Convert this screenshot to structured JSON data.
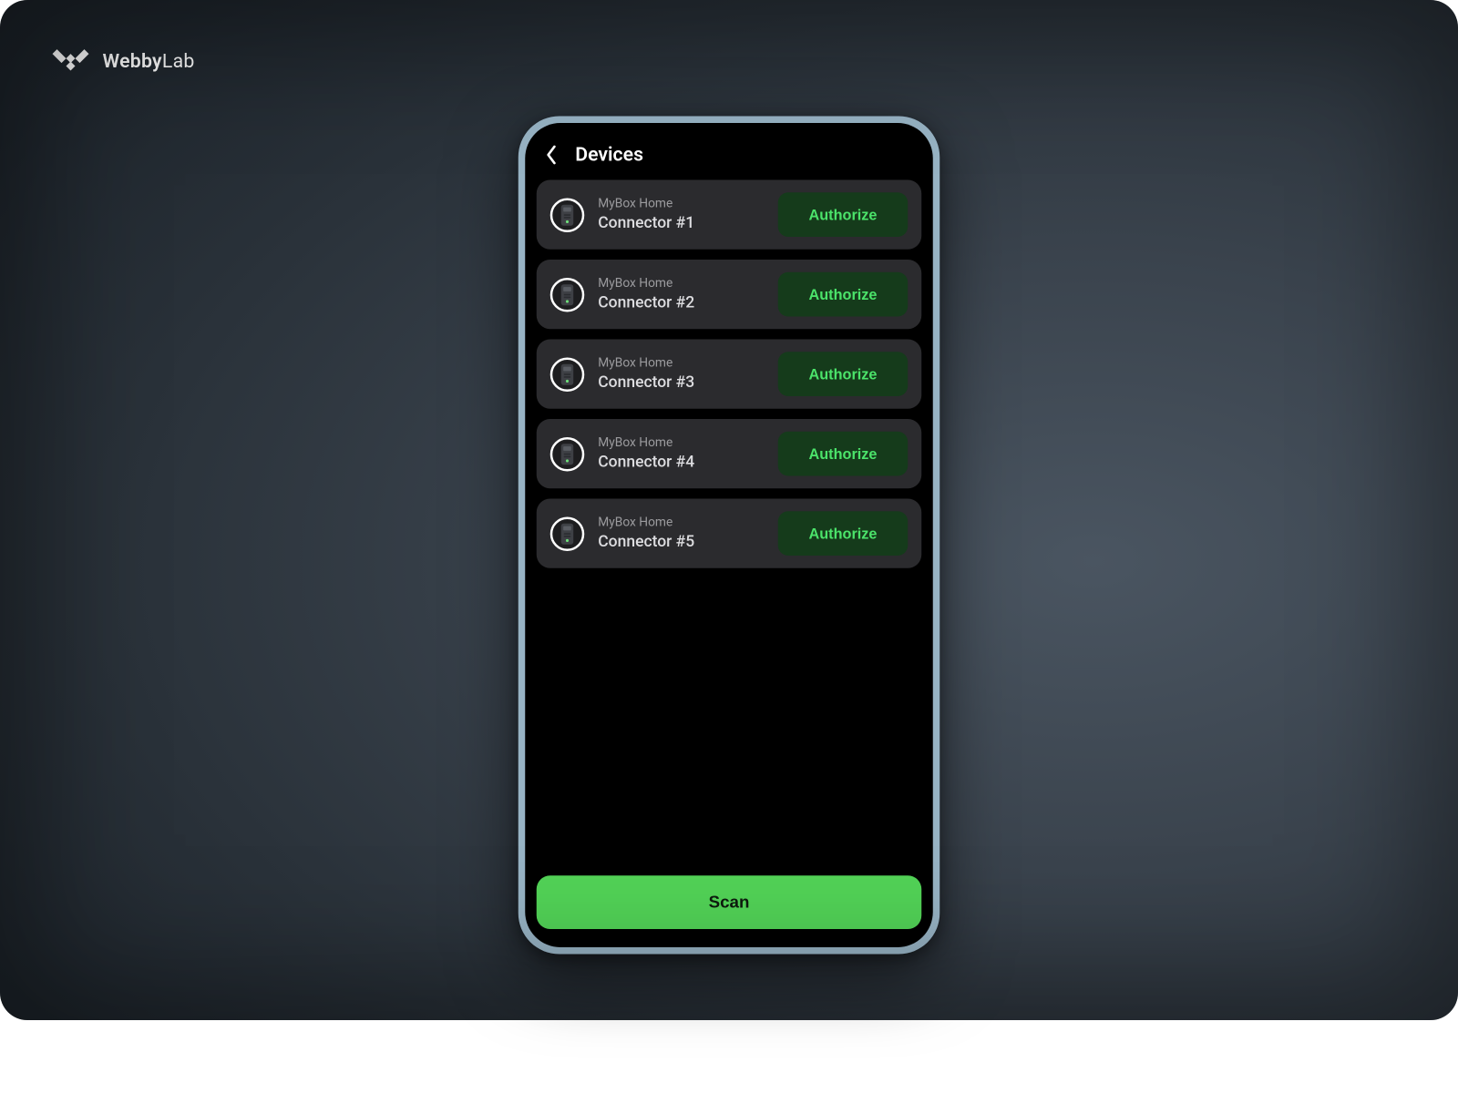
{
  "brand": {
    "name_bold": "Webby",
    "name_rest": "Lab"
  },
  "header": {
    "title": "Devices"
  },
  "devices": [
    {
      "subtitle": "MyBox Home",
      "name": "Connector #1",
      "action": "Authorize"
    },
    {
      "subtitle": "MyBox Home",
      "name": "Connector #2",
      "action": "Authorize"
    },
    {
      "subtitle": "MyBox Home",
      "name": "Connector #3",
      "action": "Authorize"
    },
    {
      "subtitle": "MyBox Home",
      "name": "Connector #4",
      "action": "Authorize"
    },
    {
      "subtitle": "MyBox Home",
      "name": "Connector #5",
      "action": "Authorize"
    }
  ],
  "scan_label": "Scan",
  "colors": {
    "accent_green": "#52d357",
    "authorize_bg": "#153b1b",
    "authorize_text": "#4be36a",
    "card_bg": "#2b2b2e"
  }
}
